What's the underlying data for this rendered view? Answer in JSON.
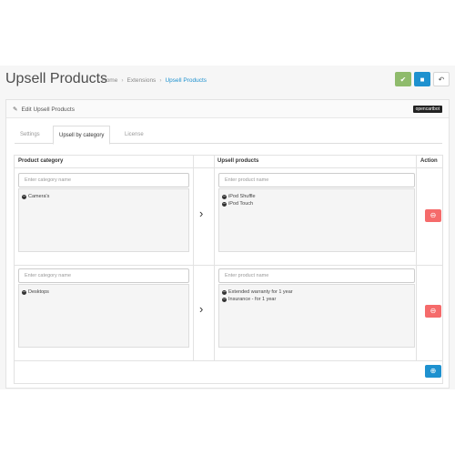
{
  "header": {
    "title": "Upsell Products",
    "breadcrumb": [
      "Home",
      "Extensions",
      "Upsell Products"
    ],
    "buttons": {
      "save_icon": "✔",
      "apply_icon": "💾",
      "back_icon": "↶"
    }
  },
  "panel": {
    "title": "Edit Upsell Products",
    "logo": "opencartbot",
    "tabs": [
      "Settings",
      "Upsell by category",
      "License"
    ]
  },
  "table": {
    "headers": [
      "Product category",
      "Upsell products",
      "Action"
    ],
    "category_placeholder": "Enter category name",
    "product_placeholder": "Enter product name",
    "rows": [
      {
        "category": "Camera's",
        "products": [
          "iPod Shuffle",
          "iPod Touch"
        ]
      },
      {
        "category": "Desktops",
        "products": [
          "Extended warranty for 1 year",
          "Insurance - for 1 year"
        ]
      }
    ]
  },
  "colors": {
    "accent": "#1e91cf",
    "save": "#8fbb6c",
    "delete": "#f56b6b"
  },
  "icons": {
    "arrow": "›",
    "delete": "⊖",
    "add": "⊕",
    "edit": "✎"
  }
}
